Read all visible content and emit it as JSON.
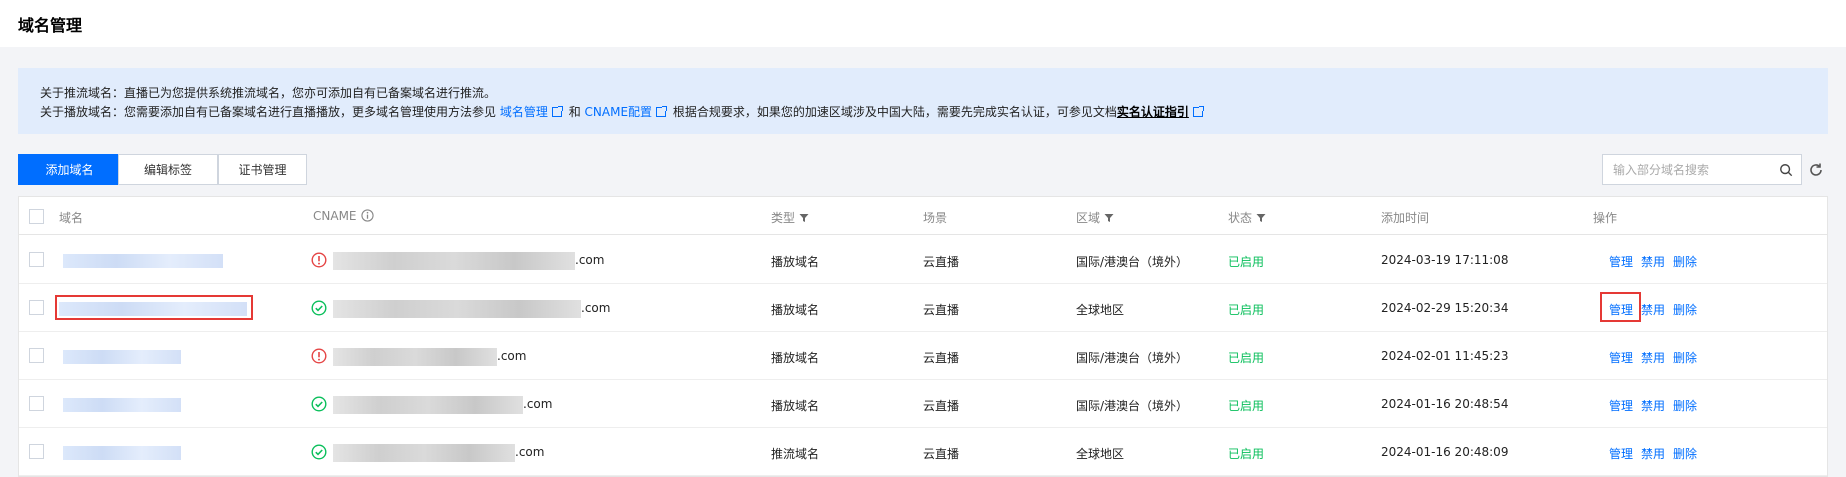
{
  "page": {
    "title": "域名管理"
  },
  "notice": {
    "line1": "关于推流域名：直播已为您提供系统推流域名，您亦可添加自有已备案域名进行推流。",
    "line2_prefix": "关于播放域名：您需要添加自有已备案域名进行直播播放，更多域名管理使用方法参见",
    "link_domain": "域名管理",
    "and": "和",
    "link_cname": "CNAME配置",
    "line2_mid": "根据合规要求，如果您的加速区域涉及中国大陆，需要先完成实名认证，可参见文档",
    "link_realname": "实名认证指引"
  },
  "toolbar": {
    "add_label": "添加域名",
    "tag_label": "编辑标签",
    "cert_label": "证书管理",
    "search_placeholder": "输入部分域名搜索"
  },
  "table": {
    "headers": {
      "domain": "域名",
      "cname": "CNAME",
      "type": "类型",
      "scene": "场景",
      "region": "区域",
      "status": "状态",
      "time": "添加时间",
      "actions": "操作"
    },
    "rows": [
      {
        "cname_state": "warning",
        "cname_suffix": ".com",
        "type": "播放域名",
        "scene": "云直播",
        "region": "国际/港澳台（境外）",
        "status": "已启用",
        "time": "2024-03-19 17:11:08",
        "manage": "管理",
        "disable": "禁用",
        "delete": "删除"
      },
      {
        "cname_state": "ok",
        "cname_suffix": ".com",
        "type": "播放域名",
        "scene": "云直播",
        "region": "全球地区",
        "status": "已启用",
        "time": "2024-02-29 15:20:34",
        "manage": "管理",
        "disable": "禁用",
        "delete": "删除"
      },
      {
        "cname_state": "warning",
        "cname_suffix": ".com",
        "type": "播放域名",
        "scene": "云直播",
        "region": "国际/港澳台（境外）",
        "status": "已启用",
        "time": "2024-02-01 11:45:23",
        "manage": "管理",
        "disable": "禁用",
        "delete": "删除"
      },
      {
        "cname_state": "ok",
        "cname_suffix": ".com",
        "type": "播放域名",
        "scene": "云直播",
        "region": "国际/港澳台（境外）",
        "status": "已启用",
        "time": "2024-01-16 20:48:54",
        "manage": "管理",
        "disable": "禁用",
        "delete": "删除"
      },
      {
        "cname_state": "ok",
        "cname_suffix": ".com",
        "type": "推流域名",
        "scene": "云直播",
        "region": "全球地区",
        "status": "已启用",
        "time": "2024-01-16 20:48:09",
        "manage": "管理",
        "disable": "禁用",
        "delete": "删除"
      }
    ]
  },
  "colors": {
    "accent": "#006eff",
    "success": "#0abf5b",
    "warning": "#e54545",
    "highlight": "#e53935"
  },
  "icons": {
    "warning": "exclamation-circle-icon",
    "ok": "check-circle-icon",
    "search": "search-icon",
    "refresh": "refresh-icon",
    "filter": "filter-icon",
    "info": "info-icon",
    "external": "external-link-icon"
  }
}
